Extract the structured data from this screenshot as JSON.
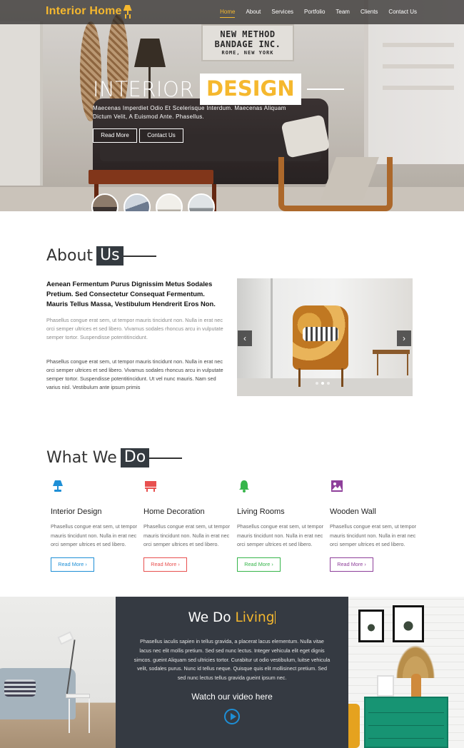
{
  "nav": {
    "brand": "Interior Home",
    "items": [
      "Home",
      "About",
      "Services",
      "Portfolio",
      "Team",
      "Clients",
      "Contact Us"
    ],
    "active": "Home"
  },
  "hero": {
    "sign": [
      "NEW METHOD",
      "BANDAGE INC.",
      "ROME, NEW YORK"
    ],
    "title_a": "INTERIOR",
    "title_b": "DESIGN",
    "subtitle": "Maecenas Imperdiet Odio Et Scelerisque Interdum. Maecenas Aliquam Dictum Velit, A Euismod Ante. Phasellus.",
    "btn_read": "Read More",
    "btn_contact": "Contact Us"
  },
  "about": {
    "title_a": "About",
    "title_b": "Us",
    "lead": "Aenean Fermentum Purus Dignissim Metus Sodales Pretium. Sed Consectetur Consequat Fermentum. Mauris Tellus Massa, Vestibulum Hendrerit Eros Non.",
    "p1": "Phasellus congue erat sem, ut tempor mauris tincidunt non. Nulla in erat nec orci semper ultrices et sed libero. Vivamus sodales rhoncus arcu in vulputate semper tortor. Suspendisse potentitincidunt.",
    "p2": "Phasellus congue erat sem, ut tempor mauris tincidunt non. Nulla in erat nec orci semper ultrices et sed libero. Vivamus sodales rhoncus arcu in vulputate semper tortor. Suspendisse potentitincidunt. Ut vel nunc mauris. Nam sed varius nisl. Vestibulum ante ipsum primis",
    "prev_glyph": "‹",
    "next_glyph": "›"
  },
  "services": {
    "title_a": "What We",
    "title_b": "Do",
    "items": [
      {
        "title": "Interior Design",
        "text": "Phasellus congue erat sem, ut tempor mauris tincidunt non. Nulla in erat nec orci semper ultrices et sed libero.",
        "btn": "Read More ›",
        "icon": "lamp-icon",
        "color": "#1e8fd6"
      },
      {
        "title": "Home Decoration",
        "text": "Phasellus congue erat sem, ut tempor mauris tincidunt non. Nulla in erat nec orci semper ultrices et sed libero.",
        "btn": "Read More ›",
        "icon": "table-icon",
        "color": "#e8504f"
      },
      {
        "title": "Living Rooms",
        "text": "Phasellus congue erat sem, ut tempor mauris tincidunt non. Nulla in erat nec orci semper ultrices et sed libero.",
        "btn": "Read More ›",
        "icon": "bell-icon",
        "color": "#36b54a"
      },
      {
        "title": "Wooden Wall",
        "text": "Phasellus congue erat sem, ut tempor mauris tincidunt non. Nulla in erat nec orci semper ultrices et sed libero.",
        "btn": "Read More ›",
        "icon": "image-icon",
        "color": "#8e3f9a"
      }
    ]
  },
  "living": {
    "title_a": "We Do",
    "title_b": "Living",
    "text": "Phasellus iaculis sapien in tellus gravida, a placerat lacus elementum. Nulla vitae lacus nec elit mollis pretium. Sed sed nunc lectus. Integer vehicula elit eget dignis simcos. gueint Aliquam sed ultricies tortor. Curabitur ut odio vestibulum, luitse vehicula velit, sodales purus. Nunc id tellus neque. Quisque quis elit mollisinect pretium. Sed sed nunc lectus tellus gravida gueint ipsum nec.",
    "video": "Watch our video here"
  },
  "colors": {
    "accent": "#f5b82e",
    "dark": "#353a42"
  }
}
